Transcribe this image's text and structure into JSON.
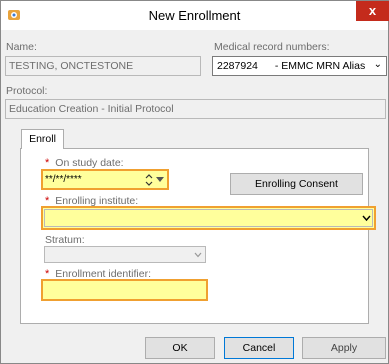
{
  "window": {
    "title": "New Enrollment",
    "close_glyph": "x"
  },
  "patient": {
    "name_label": "Name:",
    "name_value": "TESTING, ONCTESTONE",
    "mrn_label": "Medical record numbers:",
    "mrn_number": "2287924",
    "mrn_alias": "- EMMC MRN Alias"
  },
  "protocol": {
    "label": "Protocol:",
    "value": "Education Creation - Initial Protocol"
  },
  "tabs": {
    "enroll": "Enroll"
  },
  "enroll": {
    "required_marker": "*",
    "study_date_label": "On study date:",
    "study_date_value": "**/**/****",
    "consent_button": "Enrolling Consent",
    "institute_label": "Enrolling institute:",
    "stratum_label": "Stratum:",
    "identifier_label": "Enrollment identifier:"
  },
  "buttons": {
    "ok": "OK",
    "cancel": "Cancel",
    "apply": "Apply"
  },
  "colors": {
    "highlight": "#ffff9c",
    "highlight_border": "#f0a030",
    "required": "#cc0000",
    "close": "#c42b1c"
  }
}
